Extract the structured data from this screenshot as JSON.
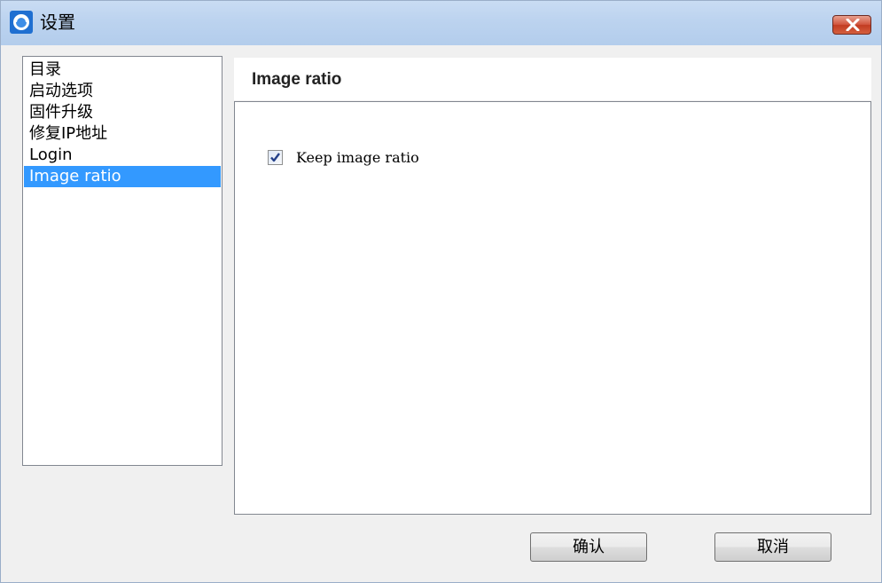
{
  "window": {
    "title": "设置",
    "app_icon": "app-logo-icon",
    "close_icon": "close-icon"
  },
  "nav": {
    "items": [
      {
        "label": "目录"
      },
      {
        "label": "启动选项"
      },
      {
        "label": "固件升级"
      },
      {
        "label": "修复IP地址"
      },
      {
        "label": "Login"
      },
      {
        "label": "Image ratio",
        "selected": true
      }
    ]
  },
  "panel": {
    "title": "Image ratio",
    "keep_ratio": {
      "label": "Keep image ratio",
      "checked": true
    }
  },
  "buttons": {
    "ok_label": "确认",
    "cancel_label": "取消"
  },
  "colors": {
    "selection": "#3399ff",
    "close_button": "#c94a2e"
  }
}
